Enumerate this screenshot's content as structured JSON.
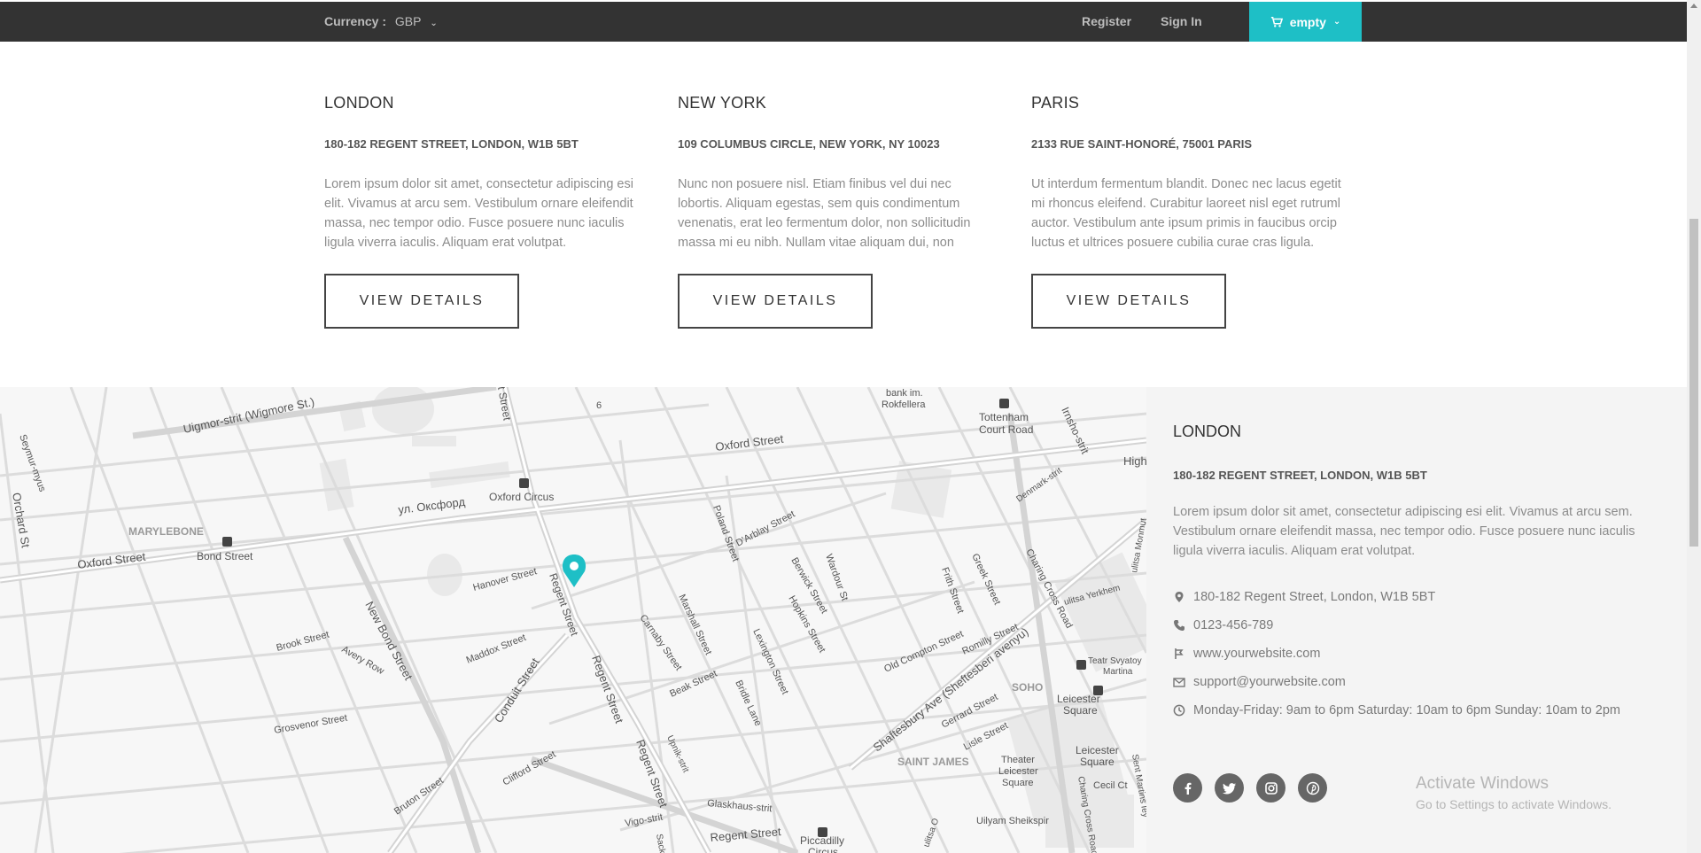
{
  "topbar": {
    "currency_label": "Currency :",
    "currency_value": "GBP",
    "register": "Register",
    "sign_in": "Sign In",
    "cart_label": "empty",
    "colors": {
      "bar": "#333333",
      "accent": "#1ebfc6"
    }
  },
  "locations": [
    {
      "title": "LONDON",
      "address": "180-182 REGENT STREET, LONDON, W1B 5BT",
      "description": "Lorem ipsum dolor sit amet, consectetur adipiscing esi elit. Vivamus at arcu sem. Vestibulum ornare eleifendit massa, nec tempor odio. Fusce posuere nunc iaculis ligula viverra iaculis. Aliquam erat volutpat.",
      "button": "VIEW DETAILS"
    },
    {
      "title": "NEW YORK",
      "address": "109 COLUMBUS CIRCLE, NEW YORK, NY 10023",
      "description": "Nunc non posuere nisl. Etiam finibus vel dui nec lobortis. Aliquam egestas, sem quis condimentum venenatis, erat leo fermentum dolor, non sollicitudin massa mi eu nibh. Nullam vitae aliquam dui, non",
      "button": "VIEW DETAILS"
    },
    {
      "title": "PARIS",
      "address": "2133 RUE SAINT-HONORÉ, 75001 PARIS",
      "description": "Ut interdum fermentum blandit. Donec nec lacus egetit mi rhoncus eleifend. Curabitur laoreet nisl eget rutruml auctor. Vestibulum ante ipsum primis in faucibus orcip luctus et ultrices posuere cubilia curae cras ligula.",
      "button": "VIEW DETAILS"
    }
  ],
  "map": {
    "labels": {
      "seymour": "Seymur-myus",
      "wigmore": "Uigmor-strit (Wigmore St.)",
      "orchard": "Orchard St",
      "marylebone": "MARYLEBONE",
      "oxford_w": "Oxford Street",
      "bond_street": "Bond Street",
      "oxford_ru": "ул. Оксфорд",
      "oxford_circus": "Oxford Circus",
      "oxford_e": "Oxford Street",
      "street_top": "t Street",
      "six": "6",
      "bank": "bank im.",
      "rokfellera": "Rokfellera",
      "tottenham1": "Tottenham",
      "tottenham2": "Court Road",
      "irnsho": "Irnsho-strit",
      "high": "High",
      "denmark": "Denmark-strit",
      "hanover": "Hanover Street",
      "regent1": "Regent Street",
      "new_bond": "New Bond Street",
      "brook": "Brook Street",
      "avery": "Avery Row",
      "maddox": "Maddox Street",
      "grosvenor": "Grosvenor Street",
      "conduit": "Conduit Street",
      "regent2": "Regent Street",
      "regent3": "Regent Street",
      "clifford": "Clifford Street",
      "bruton": "Bruton Street",
      "poland": "Poland Street",
      "darblay": "D'Arblay Street",
      "carnaby": "Carnaby Street",
      "marshall": "Marshall Street",
      "berwick": "Berwick Street",
      "hopkins": "Hopkins Street",
      "wardour": "Wardour St",
      "lexington": "Lexington Street",
      "beak": "Beak Street",
      "bridle": "Bridle Lane",
      "upnik": "Upnik-strit",
      "glasshouse": "Glaskhaus-strit",
      "vigo": "Vigo-strit",
      "regent4": "Regent Street",
      "piccadilly1": "Piccadilly",
      "piccadilly2": "Circus",
      "frith": "Frith Street",
      "greek": "Greek Street",
      "charing1": "Charing Cross Road",
      "old_compton": "Old Compton Street",
      "romilly": "Romilly Street",
      "shaftesbury": "Shaftesbury Ave (Sheftesberi avenyu)",
      "soho": "SOHO",
      "gerrard": "Gerrard Street",
      "lisle": "Lisle Street",
      "saint_james": "SAINT JAMES",
      "theater1": "Theater",
      "theater2": "Leicester",
      "theater3": "Square",
      "leicester1a": "Leicester",
      "leicester1b": "Square",
      "leicester2a": "Leicester",
      "leicester2b": "Square",
      "cecil": "Cecil Ct",
      "charing2": "Charing Cross Road",
      "st_martins": "Sent Martins Iey",
      "yerkhem": "ulitsa Yerkhem",
      "monmouth": "ulitsa Monmut",
      "teatr1": "Teatr Svyatoy",
      "teatr2": "Martina",
      "sheikspir": "Uilyam Sheikspir",
      "ulitsa_o": "ulitsa O",
      "sack": "Sack"
    }
  },
  "info": {
    "title": "LONDON",
    "address": "180-182 REGENT STREET, LONDON, W1B 5BT",
    "description": "Lorem ipsum dolor sit amet, consectetur adipiscing esi elit. Vivamus at arcu sem. Vestibulum ornare eleifendit massa, nec tempor odio. Fusce posuere nunc iaculis ligula viverra iaculis. Aliquam erat volutpat.",
    "address_line": "180-182 Regent Street, London, W1B 5BT",
    "phone": "0123-456-789",
    "website": "www.yourwebsite.com",
    "email": "support@yourwebsite.com",
    "hours": "Monday-Friday: 9am to 6pm Saturday: 10am to 6pm Sunday: 10am to 2pm",
    "social_icons": [
      "facebook-icon",
      "twitter-icon",
      "instagram-icon",
      "pinterest-icon"
    ]
  },
  "watermark": {
    "line1": "Activate Windows",
    "line2": "Go to Settings to activate Windows."
  }
}
